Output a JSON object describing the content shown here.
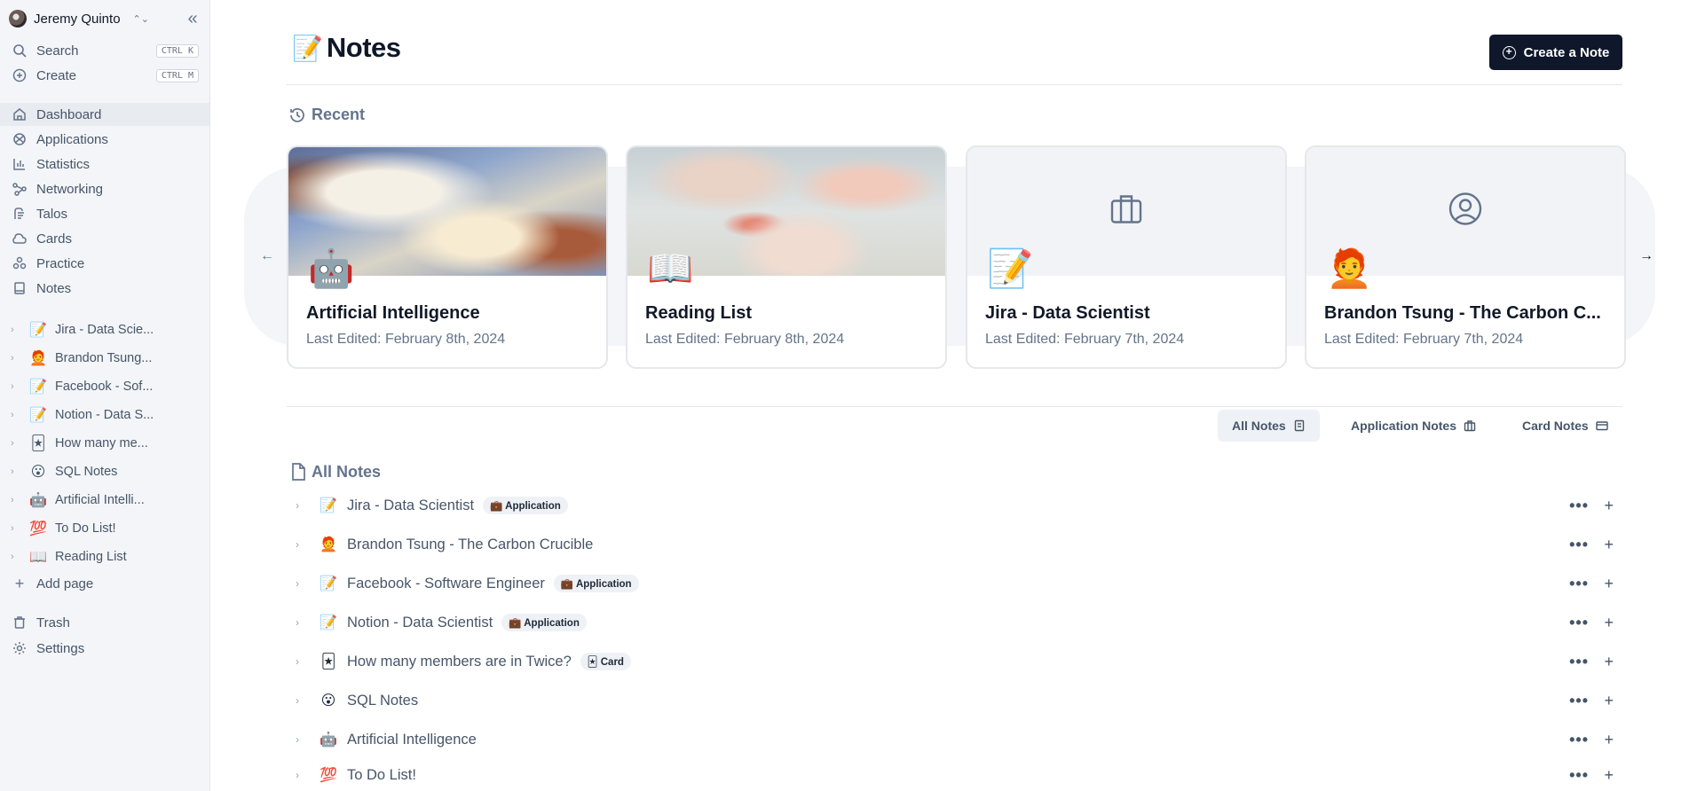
{
  "sidebar": {
    "user_name": "Jeremy Quinto",
    "quick": [
      {
        "label": "Search",
        "shortcut": "CTRL K",
        "icon": "search-icon"
      },
      {
        "label": "Create",
        "shortcut": "CTRL M",
        "icon": "plus-circle-icon"
      }
    ],
    "nav": [
      {
        "label": "Dashboard",
        "icon": "home-icon"
      },
      {
        "label": "Applications",
        "icon": "applications-icon"
      },
      {
        "label": "Statistics",
        "icon": "bar-chart-icon"
      },
      {
        "label": "Networking",
        "icon": "network-icon"
      },
      {
        "label": "Talos",
        "icon": "talos-icon"
      },
      {
        "label": "Cards",
        "icon": "cloud-icon"
      },
      {
        "label": "Practice",
        "icon": "practice-icon"
      },
      {
        "label": "Notes",
        "icon": "notebook-icon"
      }
    ],
    "pages": [
      {
        "emoji": "📝",
        "label": "Jira - Data Scie..."
      },
      {
        "emoji": "🧑‍🦰",
        "label": "Brandon Tsung..."
      },
      {
        "emoji": "📝",
        "label": "Facebook - Sof..."
      },
      {
        "emoji": "📝",
        "label": "Notion - Data S..."
      },
      {
        "emoji": "🃏",
        "label": "How many me..."
      },
      {
        "emoji": "😮",
        "label": "SQL Notes"
      },
      {
        "emoji": "🤖",
        "label": "Artificial Intelli..."
      },
      {
        "emoji": "💯",
        "label": "To Do List!"
      },
      {
        "emoji": "📖",
        "label": "Reading List"
      }
    ],
    "add_page": "Add page",
    "trash": "Trash",
    "settings": "Settings"
  },
  "header": {
    "emoji": "📝",
    "title": "Notes",
    "create_button": "Create a Note"
  },
  "recent": {
    "heading": "Recent",
    "cards": [
      {
        "emoji": "🤖",
        "title": "Artificial Intelligence",
        "date": "Last Edited: February 8th, 2024",
        "cover": "fresco-painting"
      },
      {
        "emoji": "📖",
        "title": "Reading List",
        "date": "Last Edited: February 8th, 2024",
        "cover": "fresco-painting"
      },
      {
        "emoji": "📝",
        "title": "Jira - Data Scientist",
        "date": "Last Edited: February 7th, 2024",
        "cover": "briefcase-icon"
      },
      {
        "emoji": "🧑‍🦰",
        "title": "Brandon Tsung - The Carbon C...",
        "date": "Last Edited: February 7th, 2024",
        "cover": "user-circle-icon"
      }
    ]
  },
  "tabs": [
    {
      "label": "All Notes",
      "icon": "notebook-icon",
      "active": true
    },
    {
      "label": "Application Notes",
      "icon": "briefcase-icon",
      "active": false
    },
    {
      "label": "Card Notes",
      "icon": "card-icon",
      "active": false
    }
  ],
  "all_notes": {
    "heading": "All Notes",
    "rows": [
      {
        "emoji": "📝",
        "title": "Jira - Data Scientist",
        "badge": "💼 Application"
      },
      {
        "emoji": "🧑‍🦰",
        "title": "Brandon Tsung - The Carbon Crucible",
        "badge": ""
      },
      {
        "emoji": "📝",
        "title": "Facebook - Software Engineer",
        "badge": "💼 Application"
      },
      {
        "emoji": "📝",
        "title": "Notion - Data Scientist",
        "badge": "💼 Application"
      },
      {
        "emoji": "🃏",
        "title": "How many members are in Twice?",
        "badge": "🃏 Card"
      },
      {
        "emoji": "😮",
        "title": "SQL Notes",
        "badge": ""
      },
      {
        "emoji": "🤖",
        "title": "Artificial Intelligence",
        "badge": ""
      },
      {
        "emoji": "💯",
        "title": "To Do List!",
        "badge": ""
      }
    ]
  }
}
